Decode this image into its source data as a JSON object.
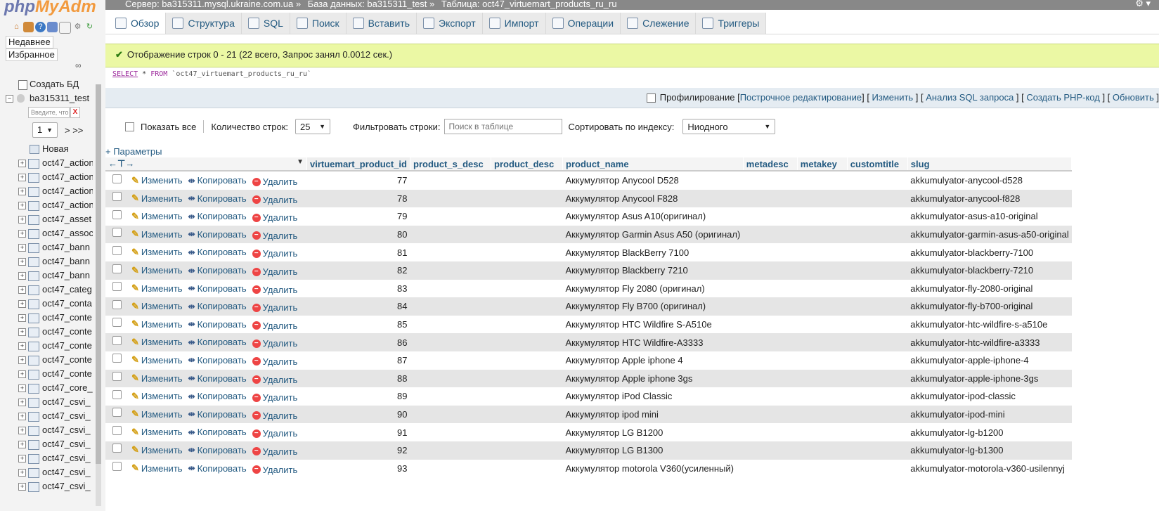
{
  "logo": {
    "part1": "php",
    "part2": "MyAdm"
  },
  "nav": {
    "recent": "Недавнее",
    "favorites": "Избранное",
    "create_db": "Создать БД",
    "db_name": "ba315311_test",
    "filter_placeholder": "Введите, что",
    "filter_clear": "X",
    "page_select": "1",
    "page_next": "> >>",
    "new_label": "Новая",
    "tables": [
      "oct47_action",
      "oct47_action",
      "oct47_action",
      "oct47_action",
      "oct47_asset",
      "oct47_assoc",
      "oct47_bann",
      "oct47_bann",
      "oct47_bann",
      "oct47_categ",
      "oct47_conta",
      "oct47_conte",
      "oct47_conte",
      "oct47_conte",
      "oct47_conte",
      "oct47_conte",
      "oct47_core_",
      "oct47_csvi_",
      "oct47_csvi_",
      "oct47_csvi_",
      "oct47_csvi_",
      "oct47_csvi_",
      "oct47_csvi_",
      "oct47_csvi_"
    ]
  },
  "breadcrumb": {
    "server": "Сервер: ba315311.mysql.ukraine.com.ua »",
    "db": "База данных: ba315311_test »",
    "table": "Таблица: oct47_virtuemart_products_ru_ru"
  },
  "tabs": [
    "Обзор",
    "Структура",
    "SQL",
    "Поиск",
    "Вставить",
    "Экспорт",
    "Импорт",
    "Операции",
    "Слежение",
    "Триггеры"
  ],
  "message": "Отображение строк 0 - 21 (22 всего, Запрос занял 0.0012 сек.)",
  "sql": {
    "select": "SELECT",
    "star": "*",
    "from": "FROM",
    "table": "`oct47_virtuemart_products_ru_ru`"
  },
  "sqlbar": {
    "profiling": "Профилирование",
    "inline_edit": "Построчное редактирование",
    "edit": "Изменить",
    "explain": "Анализ SQL запроса",
    "php": "Создать PHP-код",
    "refresh": "Обновить"
  },
  "controls": {
    "show_all": "Показать все",
    "row_count_label": "Количество строк:",
    "row_count": "25",
    "filter_label": "Фильтровать строки:",
    "filter_placeholder": "Поиск в таблице",
    "sort_label": "Сортировать по индексу:",
    "sort_value": "Ниодного"
  },
  "params": "+ Параметры",
  "actions": {
    "edit": "Изменить",
    "copy": "Копировать",
    "delete": "Удалить"
  },
  "columns": [
    "virtuemart_product_id",
    "product_s_desc",
    "product_desc",
    "product_name",
    "metadesc",
    "metakey",
    "customtitle",
    "slug"
  ],
  "rows": [
    {
      "id": "77",
      "name": "Аккумулятор Anycool D528",
      "slug": "akkumulyator-anycool-d528"
    },
    {
      "id": "78",
      "name": "Аккумулятор Anycool F828",
      "slug": "akkumulyator-anycool-f828"
    },
    {
      "id": "79",
      "name": "Аккумулятор Asus A10(оригинал)",
      "slug": "akkumulyator-asus-a10-original"
    },
    {
      "id": "80",
      "name": "Аккумулятор Garmin Asus A50 (оригинал)",
      "slug": "akkumulyator-garmin-asus-a50-original"
    },
    {
      "id": "81",
      "name": "Аккумулятор BlackBerry 7100",
      "slug": "akkumulyator-blackberry-7100"
    },
    {
      "id": "82",
      "name": "Аккумулятор Blackberry 7210",
      "slug": "akkumulyator-blackberry-7210"
    },
    {
      "id": "83",
      "name": "Аккумулятор Fly 2080 (оригинал)",
      "slug": "akkumulyator-fly-2080-original"
    },
    {
      "id": "84",
      "name": "Аккумулятор Fly B700 (оригинал)",
      "slug": "akkumulyator-fly-b700-original"
    },
    {
      "id": "85",
      "name": "Аккумулятор HTC Wildfire S-A510e",
      "slug": "akkumulyator-htc-wildfire-s-a510e"
    },
    {
      "id": "86",
      "name": "Аккумулятор HTC Wildfire-A3333",
      "slug": "akkumulyator-htc-wildfire-a3333"
    },
    {
      "id": "87",
      "name": "Аккумулятор Apple iphone 4",
      "slug": "akkumulyator-apple-iphone-4"
    },
    {
      "id": "88",
      "name": "Аккумулятор Apple iphone 3gs",
      "slug": "akkumulyator-apple-iphone-3gs"
    },
    {
      "id": "89",
      "name": "Аккумулятор iPod Classic",
      "slug": "akkumulyator-ipod-classic"
    },
    {
      "id": "90",
      "name": "Аккумулятор ipod mini",
      "slug": "akkumulyator-ipod-mini"
    },
    {
      "id": "91",
      "name": "Аккумулятор LG B1200",
      "slug": "akkumulyator-lg-b1200"
    },
    {
      "id": "92",
      "name": "Аккумулятор LG B1300",
      "slug": "akkumulyator-lg-b1300"
    },
    {
      "id": "93",
      "name": "Аккумулятор motorola V360(усиленный)",
      "slug": "akkumulyator-motorola-v360-usilennyj"
    }
  ]
}
